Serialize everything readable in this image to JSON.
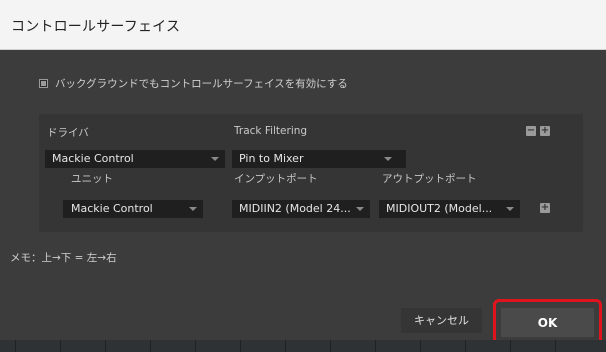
{
  "dialog": {
    "title": "コントロールサーフェイス",
    "background_checkbox_label": "バックグラウンドでもコントロールサーフェイスを有効にする",
    "background_checkbox_checked": true,
    "headers": {
      "driver": "ドライバ",
      "track_filtering": "Track Filtering",
      "unit": "ユニット",
      "input_port": "インプットポート",
      "output_port": "アウトプットポート"
    },
    "driver_value": "Mackie Control",
    "track_filtering_value": "Pin to Mixer",
    "unit_value": "Mackie Control",
    "input_port_value": "MIDIIN2 (Model 24...",
    "output_port_value": "MIDIOUT2 (Model...",
    "remove_icon_label": "−",
    "add_icon_label": "+",
    "memo": "メモ：上→下 = 左→右",
    "cancel_label": "キャンセル",
    "ok_label": "OK",
    "highlight_color": "#e0141c"
  }
}
